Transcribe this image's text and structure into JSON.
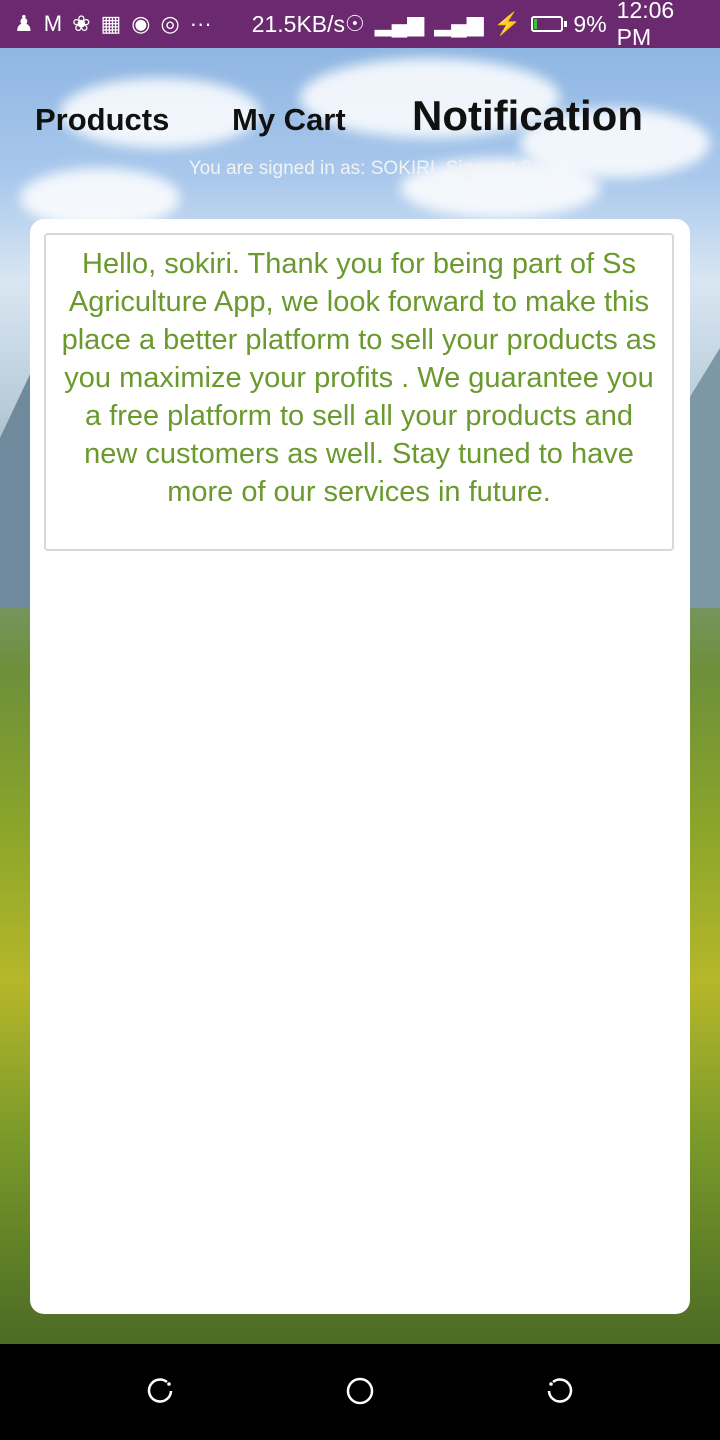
{
  "status_bar": {
    "icons": [
      "add-contact-icon",
      "gmail-icon",
      "app-icon",
      "cast-icon",
      "photo-icon",
      "radio-icon",
      "more-icon"
    ],
    "more_label": "···",
    "net_speed": "21.5KB/s",
    "battery_percent": "9%",
    "battery_level": 9,
    "time": "12:06 PM"
  },
  "nav": {
    "products": "Products",
    "my_cart": "My Cart",
    "notification": "Notification"
  },
  "signed_in": {
    "prefix": "You are signed in as: ",
    "user": "SOKIRI",
    "sign_out": "Sign out ?"
  },
  "message": {
    "text": "Hello,  sokiri. Thank you for being part of Ss Agriculture App, we look forward to make this place a better platform to sell your products as you maximize your profits . We guarantee you a free platform to sell all your products and new customers as well. Stay tuned to have more of our services in future.",
    "color": "#6a9a2e"
  },
  "colors": {
    "status_bar": "#6b2a70",
    "card": "#ffffff"
  }
}
